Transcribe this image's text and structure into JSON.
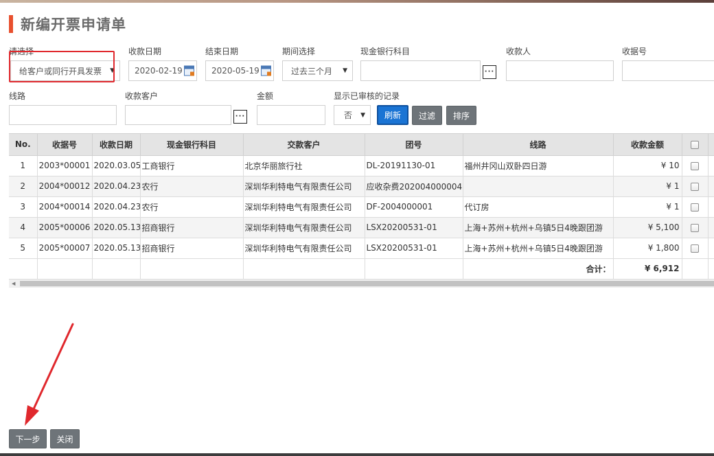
{
  "page": {
    "title": "新编开票申请单"
  },
  "filters": {
    "select_label": "请选择",
    "select_value": "给客户或同行开具发票",
    "start_date_label": "收款日期",
    "start_date": "2020-02-19",
    "end_date_label": "结束日期",
    "end_date": "2020-05-19",
    "period_label": "期间选择",
    "period_value": "过去三个月",
    "bank_label": "现金银行科目",
    "bank_value": "",
    "payee_label": "收款人",
    "payee_value": "",
    "receipt_label": "收据号",
    "receipt_value": "",
    "route_label": "线路",
    "route_value": "",
    "customer_label": "收款客户",
    "customer_value": "",
    "amount_label": "金额",
    "amount_value": "",
    "audited_label": "显示已审核的记录",
    "audited_value": "否"
  },
  "toolbar": {
    "refresh": "刷新",
    "filter": "过滤",
    "sort": "排序"
  },
  "table": {
    "columns": [
      "No.",
      "收据号",
      "收款日期",
      "现金银行科目",
      "交款客户",
      "团号",
      "线路",
      "收款金额"
    ],
    "rows": [
      {
        "no": "1",
        "receipt": "2003*00001",
        "date": "2020.03.05",
        "bank": "工商银行",
        "customer": "北京华丽旅行社",
        "group": "DL-20191130-01",
        "route": "福州井冈山双卧四日游",
        "amount": "¥ 10"
      },
      {
        "no": "2",
        "receipt": "2004*00012",
        "date": "2020.04.23",
        "bank": "农行",
        "customer": "深圳华利特电气有限责任公司",
        "group": "应收杂费202004000004",
        "route": "",
        "amount": "¥ 1"
      },
      {
        "no": "3",
        "receipt": "2004*00014",
        "date": "2020.04.23",
        "bank": "农行",
        "customer": "深圳华利特电气有限责任公司",
        "group": "DF-2004000001",
        "route": "代订房",
        "amount": "¥ 1"
      },
      {
        "no": "4",
        "receipt": "2005*00006",
        "date": "2020.05.13",
        "bank": "招商银行",
        "customer": "深圳华利特电气有限责任公司",
        "group": "LSX20200531-01",
        "route": "上海+苏州+杭州+乌镇5日4晚跟团游",
        "amount": "¥ 5,100"
      },
      {
        "no": "5",
        "receipt": "2005*00007",
        "date": "2020.05.13",
        "bank": "招商银行",
        "customer": "深圳华利特电气有限责任公司",
        "group": "LSX20200531-01",
        "route": "上海+苏州+杭州+乌镇5日4晚跟团游",
        "amount": "¥ 1,800"
      }
    ],
    "total_label": "合计：",
    "total_value": "¥ 6,912"
  },
  "footer": {
    "next": "下一步",
    "close": "关闭"
  },
  "colors": {
    "accent": "#e8502e",
    "primary": "#1a74d4",
    "annotation": "#e0282d"
  }
}
